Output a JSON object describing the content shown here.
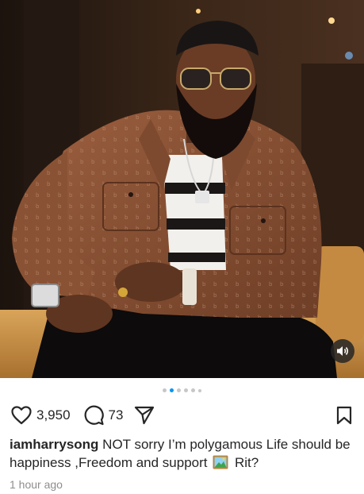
{
  "post": {
    "username": "iamharrysong",
    "caption_part1": "NOT sorry I’m  polygamous  Life should be happiness ,Freedom and support",
    "caption_emoji": "framed-picture-emoji",
    "caption_part2": "Rit?",
    "likes_count": "3,950",
    "comments_count": "73",
    "timestamp": "1 hour ago",
    "carousel": {
      "total_dots": 6,
      "active_index": 1
    }
  },
  "icons": {
    "like": "heart-outline-icon",
    "comment": "speech-bubble-icon",
    "share": "paper-plane-icon",
    "save": "bookmark-icon",
    "sound": "speaker-icon"
  },
  "colors": {
    "text": "#262626",
    "muted": "#8e8e8e",
    "active_dot": "#0095f6",
    "inactive_dot": "#c7c7c7"
  }
}
